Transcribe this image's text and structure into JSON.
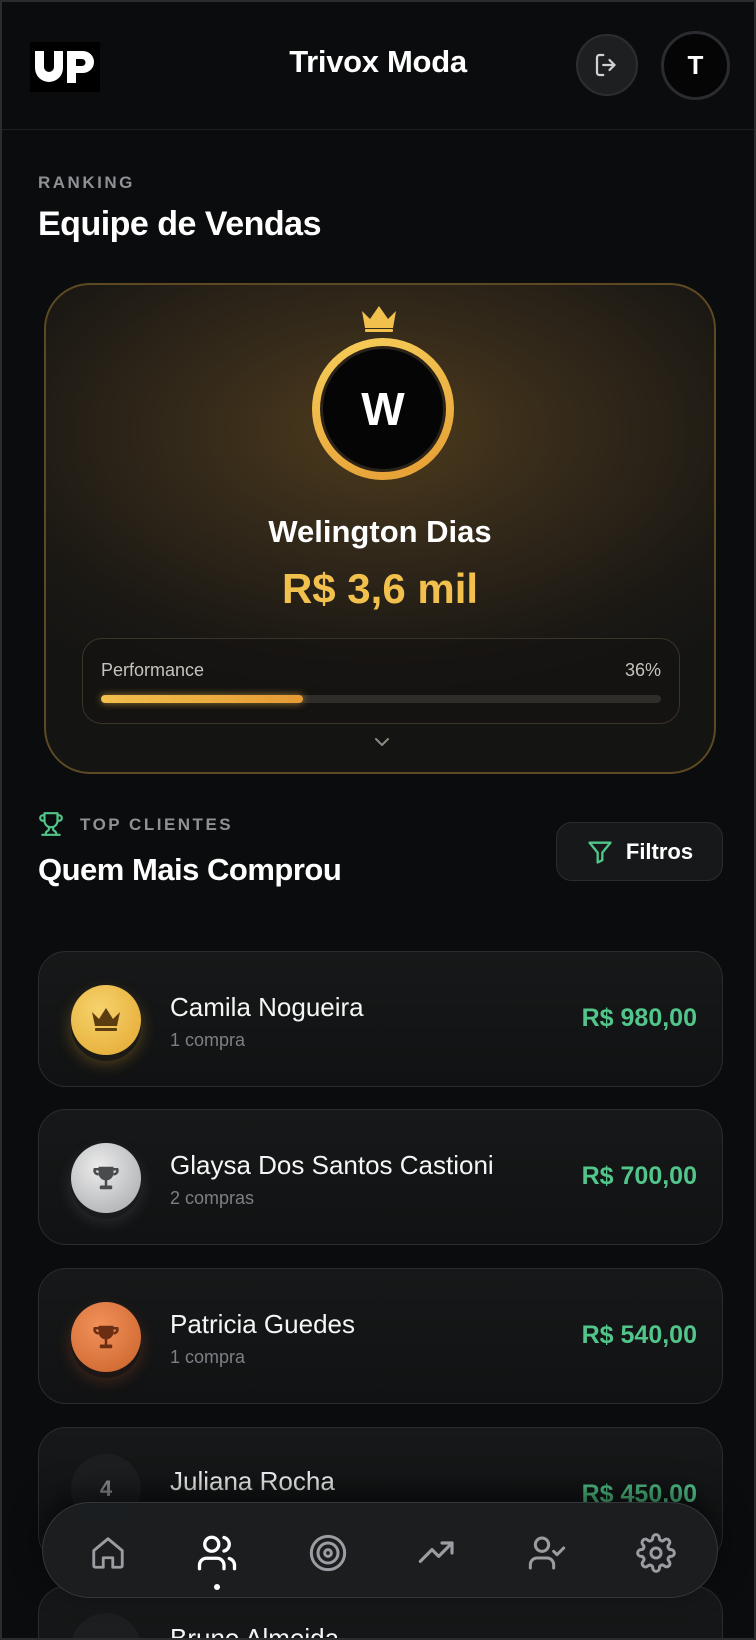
{
  "header": {
    "app_title": "Trivox Moda",
    "logo_text": "UP",
    "user_initial": "T"
  },
  "ranking": {
    "label": "RANKING",
    "title": "Equipe de Vendas",
    "leader": {
      "initial": "W",
      "name": "Welington Dias",
      "value": "R$ 3,6 mil",
      "performance_label": "Performance",
      "performance_pct_text": "36%",
      "performance_fraction": 0.36
    }
  },
  "top_clients": {
    "label": "TOP CLIENTES",
    "title": "Quem Mais Comprou",
    "filter_label": "Filtros",
    "clients": [
      {
        "rank": "1",
        "name": "Camila Nogueira",
        "purchases": "1 compra",
        "amount": "R$ 980,00",
        "medal": "gold"
      },
      {
        "rank": "2",
        "name": "Glaysa Dos Santos Castioni",
        "purchases": "2 compras",
        "amount": "R$ 700,00",
        "medal": "silver"
      },
      {
        "rank": "3",
        "name": "Patricia Guedes",
        "purchases": "1 compra",
        "amount": "R$ 540,00",
        "medal": "bronze"
      },
      {
        "rank": "4",
        "name": "Juliana Rocha",
        "purchases": "",
        "amount": "R$ 450,00",
        "medal": "none"
      },
      {
        "rank": "",
        "name": "Bruno Almeida",
        "purchases": "",
        "amount": "",
        "medal": "none"
      }
    ]
  },
  "nav": {
    "items": [
      "home-icon",
      "users-icon",
      "target-icon",
      "trending-up-icon",
      "user-check-icon",
      "settings-icon"
    ],
    "active_index": 1
  },
  "colors": {
    "accent_gold": "#f2c04c",
    "amount_green": "#52c68a",
    "background": "#0b0c0d"
  }
}
